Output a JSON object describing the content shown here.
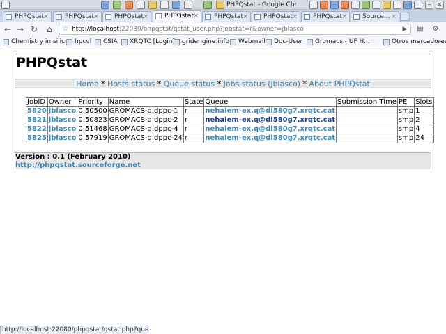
{
  "window": {
    "title": "PHPQstat - Google Chrome"
  },
  "tabs": [
    {
      "label": "PHPQstat"
    },
    {
      "label": "PHPQstat"
    },
    {
      "label": "PHPQstat"
    },
    {
      "label": "PHPQstat"
    },
    {
      "label": "PHPQstat"
    },
    {
      "label": "PHPQstat"
    },
    {
      "label": "PHPQstat"
    },
    {
      "label": "Source..."
    }
  ],
  "tab_close_glyph": "×",
  "toolbar": {
    "url_host": "http://localhost",
    "url_rest": ":22080/phpqstat/qstat_user.php?jobstat=r&owner=jblasco"
  },
  "bookmarks": [
    {
      "label": "Chemistry in silico"
    },
    {
      "label": "hpcvl"
    },
    {
      "label": "CSIA"
    },
    {
      "label": "XRQTC [Login]"
    },
    {
      "label": "gridengine.info"
    },
    {
      "label": "Webmail"
    },
    {
      "label": "Doc-User"
    },
    {
      "label": "Gromacs - UF H..."
    },
    {
      "label": "Otros marcadores"
    }
  ],
  "page": {
    "title": "PHPQstat",
    "nav": {
      "home": "Home",
      "hosts": "Hosts status",
      "queue": "Queue status",
      "jobs": "Jobs status (jblasco)",
      "about": "About PHPQstat",
      "sep": " * "
    },
    "table": {
      "headers": [
        "JobID",
        "Owner",
        "Priority",
        "Name",
        "State",
        "Queue",
        "Submission Time",
        "PE",
        "Slots"
      ],
      "rows": [
        {
          "jobid": "5820",
          "owner": "jblasco",
          "priority": "0.50500",
          "name": "GROMACS-d.dppc-1",
          "state": "r",
          "queue": "nehalem-ex.q@dl580g7.xrqtc.cat",
          "submission": "",
          "pe": "smp",
          "slots": "1"
        },
        {
          "jobid": "5821",
          "owner": "jblasco",
          "priority": "0.50823",
          "name": "GROMACS-d.dppc-2",
          "state": "r",
          "queue": "nehalem-ex.q@dl580g7.xrqtc.cat",
          "submission": "",
          "pe": "smp",
          "slots": "2"
        },
        {
          "jobid": "5822",
          "owner": "jblasco",
          "priority": "0.51468",
          "name": "GROMACS-d.dppc-4",
          "state": "r",
          "queue": "nehalem-ex.q@dl580g7.xrqtc.cat",
          "submission": "",
          "pe": "smp",
          "slots": "4"
        },
        {
          "jobid": "5825",
          "owner": "jblasco",
          "priority": "0.57919",
          "name": "GROMACS-d.dppc-24",
          "state": "r",
          "queue": "nehalem-ex.q@dl580g7.xrqtc.cat",
          "submission": "",
          "pe": "smp",
          "slots": "24"
        }
      ]
    },
    "version": "Version : 0.1 (February 2010)",
    "project_link": "http://phpqstat.sourceforge.net"
  },
  "status_bar": "http://localhost:22080/phpqstat/qstat.php?queue=...",
  "colors": {
    "link": "#3a8abf",
    "nav_link": "#3a7fa8",
    "visited": "#1f3f8f",
    "nav_bg": "#e6e6e6"
  }
}
